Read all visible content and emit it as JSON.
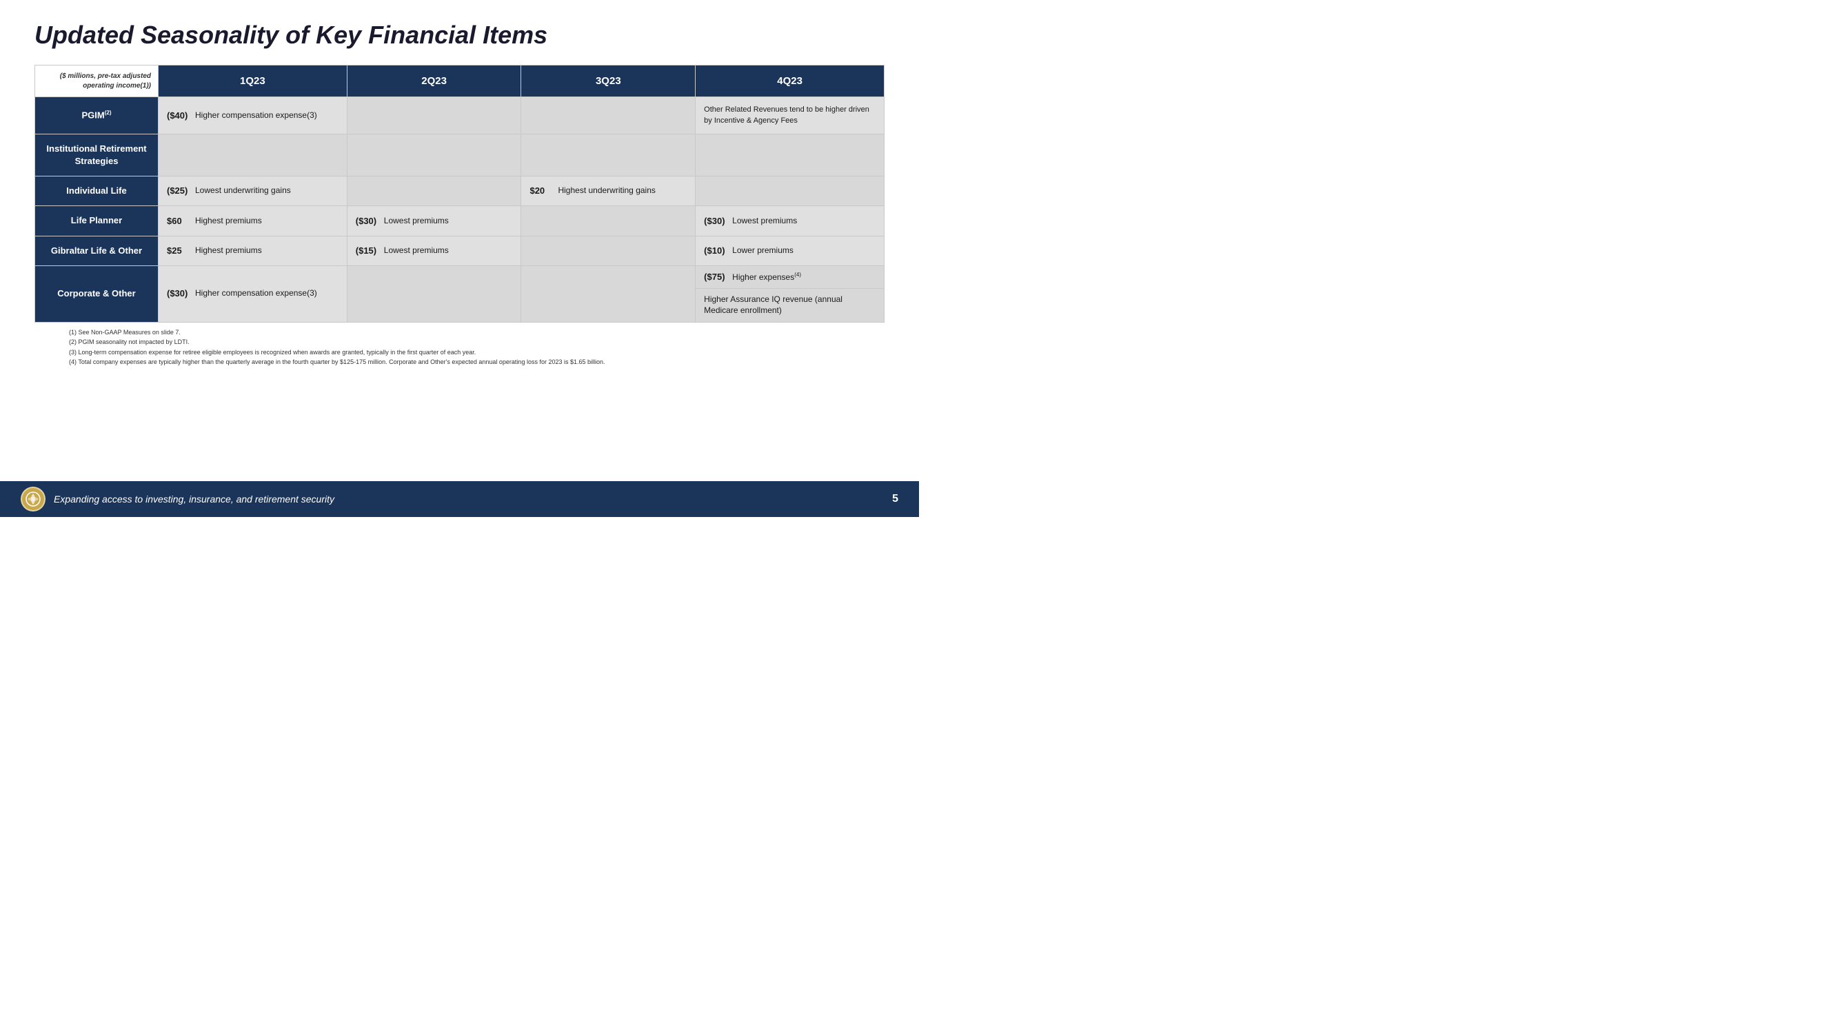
{
  "page": {
    "title": "Updated Seasonality of Key Financial Items"
  },
  "table": {
    "header": {
      "label_text": "($ millions, pre-tax adjusted operating income(1))",
      "cols": [
        "1Q23",
        "2Q23",
        "3Q23",
        "4Q23"
      ]
    },
    "rows": [
      {
        "label": "PGIM",
        "label_sup": "(2)",
        "q1": {
          "amount": "($40)",
          "desc": "Higher compensation expense(3)"
        },
        "q4": {
          "desc": "Other Related Revenues tend to be higher driven by Incentive & Agency Fees"
        }
      },
      {
        "label": "Institutional Retirement Strategies"
      },
      {
        "label": "Individual Life",
        "q1": {
          "amount": "($25)",
          "desc": "Lowest underwriting gains"
        },
        "q3": {
          "amount": "$20",
          "desc": "Highest underwriting gains"
        }
      },
      {
        "label": "Life Planner",
        "q1": {
          "amount": "$60",
          "desc": "Highest premiums"
        },
        "q2": {
          "amount": "($30)",
          "desc": "Lowest premiums"
        },
        "q4": {
          "amount": "($30)",
          "desc": "Lowest premiums"
        }
      },
      {
        "label": "Gibraltar Life & Other",
        "q1": {
          "amount": "$25",
          "desc": "Highest premiums"
        },
        "q2": {
          "amount": "($15)",
          "desc": "Lowest premiums"
        },
        "q4": {
          "amount": "($10)",
          "desc": "Lower premiums"
        }
      },
      {
        "label": "Corporate & Other",
        "q1": {
          "amount": "($30)",
          "desc": "Higher compensation expense(3)"
        },
        "q4": {
          "amount1": "($75)",
          "desc1": "Higher expenses",
          "desc1_sup": "(4)",
          "amount2": "",
          "desc2": "Higher Assurance IQ revenue (annual Medicare enrollment)"
        }
      }
    ]
  },
  "footnotes": [
    "(1)  See Non-GAAP Measures on slide 7.",
    "(2)  PGIM seasonality not impacted by LDTI.",
    "(3)  Long-term compensation expense for retiree eligible employees is recognized when awards are granted, typically in the first quarter of each year.",
    "(4)  Total company expenses are typically higher than the quarterly average in the fourth quarter by $125-175 million. Corporate and Other's expected annual operating loss for 2023 is $1.65 billion."
  ],
  "footer": {
    "tagline": "Expanding access to investing, insurance, and retirement security",
    "page_number": "5"
  }
}
